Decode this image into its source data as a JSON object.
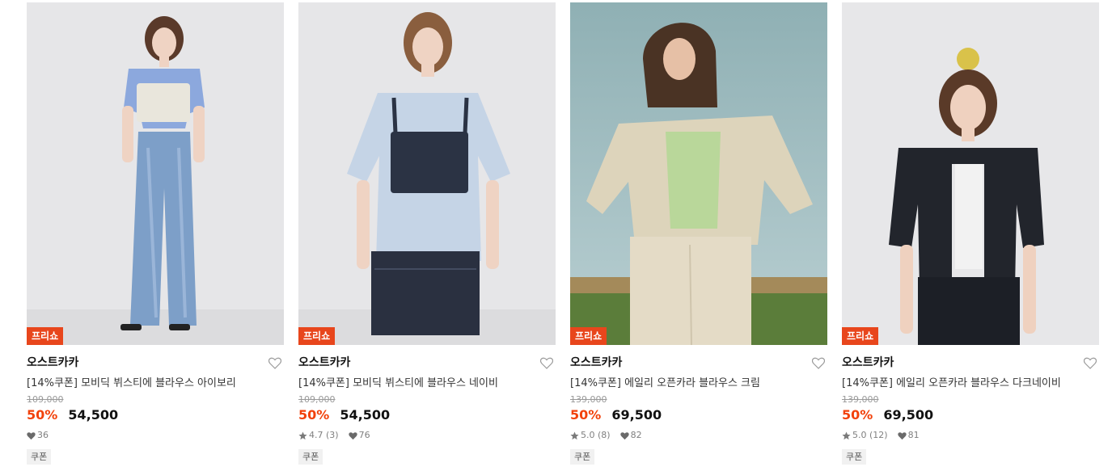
{
  "products": [
    {
      "badge": "프리쇼",
      "brand": "오스트카카",
      "title": "[14%쿠폰] 모비딕 뷔스티에 블라우스 아이보리",
      "original_price": "109,000",
      "discount": "50%",
      "price": "54,500",
      "rating": "",
      "likes": "36",
      "coupon": "쿠폰"
    },
    {
      "badge": "프리쇼",
      "brand": "오스트카카",
      "title": "[14%쿠폰] 모비딕 뷔스티에 블라우스 네이비",
      "original_price": "109,000",
      "discount": "50%",
      "price": "54,500",
      "rating": "4.7 (3)",
      "likes": "76",
      "coupon": "쿠폰"
    },
    {
      "badge": "프리쇼",
      "brand": "오스트카카",
      "title": "[14%쿠폰] 에일리 오픈카라 블라우스 크림",
      "original_price": "139,000",
      "discount": "50%",
      "price": "69,500",
      "rating": "5.0 (8)",
      "likes": "82",
      "coupon": "쿠폰"
    },
    {
      "badge": "프리쇼",
      "brand": "오스트카카",
      "title": "[14%쿠폰] 에일리 오픈카라 블라우스 다크네이비",
      "original_price": "139,000",
      "discount": "50%",
      "price": "69,500",
      "rating": "5.0 (12)",
      "likes": "81",
      "coupon": "쿠폰"
    }
  ],
  "colors": {
    "badge": "#e8461c",
    "discount": "#f2420b"
  },
  "icons": [
    "heart-outline-icon",
    "star-icon",
    "heart-filled-icon"
  ]
}
